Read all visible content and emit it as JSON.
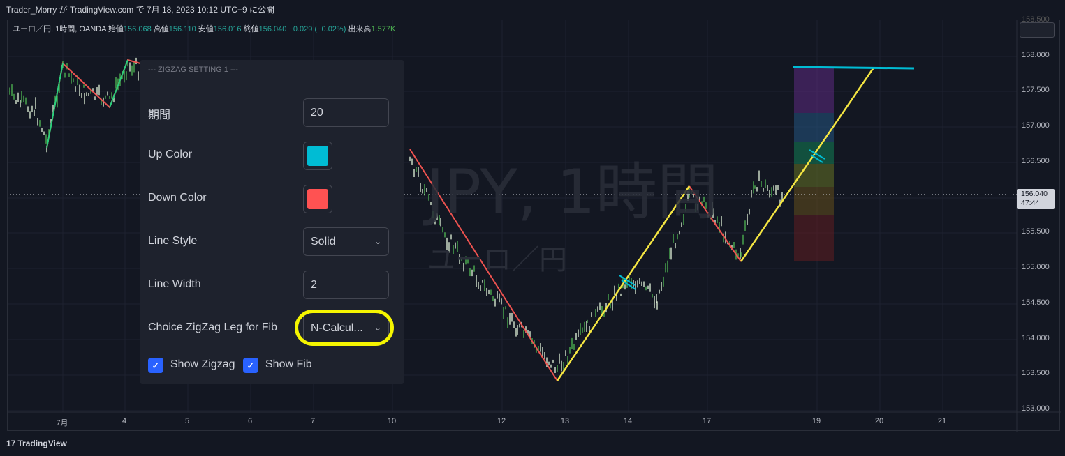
{
  "topbar": {
    "publisher": "Trader_Morry が TradingView.com で 7月 18, 2023 10:12 UTC+9 に公開"
  },
  "legend": {
    "symbol": "ユーロ／円, 1時間, OANDA",
    "open_label": "始値",
    "open": "156.068",
    "high_label": "高値",
    "high": "156.110",
    "low_label": "安値",
    "low": "156.016",
    "close_label": "終値",
    "close": "156.040",
    "change": "−0.029 (−0.02%)",
    "volume_label": "出来高",
    "volume": "1.577K"
  },
  "watermark": {
    "line1": "JPY, 1時間",
    "line2": "ユーロ／円"
  },
  "y_axis": {
    "top_cut_label": "158.500",
    "labels": [
      "158.000",
      "157.500",
      "157.000",
      "156.500",
      "156.000",
      "155.500",
      "155.000",
      "154.500",
      "154.000",
      "153.500",
      "153.000"
    ],
    "current_price": "156.040",
    "countdown": "47:44"
  },
  "x_axis": {
    "labels": [
      "7月",
      "4",
      "5",
      "6",
      "7",
      "10",
      "12",
      "13",
      "14",
      "17",
      "19",
      "20",
      "21"
    ]
  },
  "branding": {
    "logo_mark": "17",
    "name": "TradingView"
  },
  "colors": {
    "background": "#131722",
    "zigzag_up": "#26d07c",
    "zigzag_down": "#ef5350",
    "fib_leg": "#f5e642",
    "fib_target": "#00bcd4",
    "candle": "#4caf50"
  },
  "panel": {
    "title": "--- ZIGZAG SETTING 1 ---",
    "period_label": "期間",
    "period_value": "20",
    "up_color_label": "Up Color",
    "up_color": "#00bcd4",
    "down_color_label": "Down Color",
    "down_color": "#ff5252",
    "line_style_label": "Line Style",
    "line_style_value": "Solid",
    "line_width_label": "Line Width",
    "line_width_value": "2",
    "fib_leg_label": "Choice ZigZag Leg for Fib",
    "fib_leg_value": "N-Calcul...",
    "show_zigzag_label": "Show Zigzag",
    "show_zigzag_checked": true,
    "show_fib_label": "Show Fib",
    "show_fib_checked": true,
    "check_glyph": "✓",
    "chevron_glyph": "⌄"
  }
}
